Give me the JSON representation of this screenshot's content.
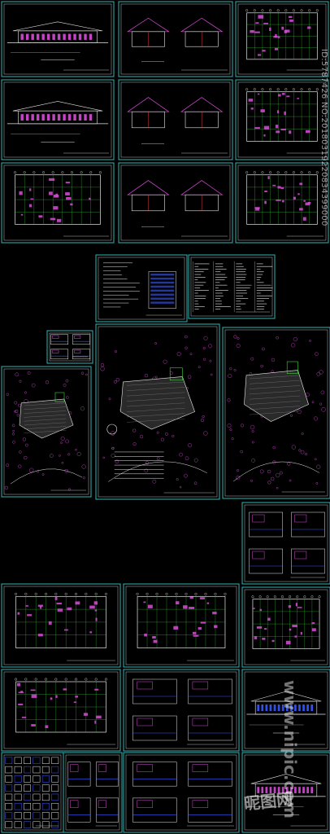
{
  "image_kind": "collage of architectural CAD drawing sheets on black background",
  "colors": {
    "frame": "#2fb6b6",
    "magenta": "#d94cd9",
    "white": "#e8e8e8",
    "green": "#3fd63f",
    "blue": "#3a5bff",
    "yellow": "#d8d84a",
    "red": "#e04040"
  },
  "sheets": [
    {
      "name": "sheet-elevation-1",
      "kind": "elevation"
    },
    {
      "name": "sheet-elevation-pair-1",
      "kind": "elevation-pair"
    },
    {
      "name": "sheet-plan-1",
      "kind": "plan"
    },
    {
      "name": "sheet-elevation-2",
      "kind": "elevation"
    },
    {
      "name": "sheet-sections-1",
      "kind": "sections"
    },
    {
      "name": "sheet-plan-2",
      "kind": "plan"
    },
    {
      "name": "sheet-roof-plan",
      "kind": "roof-plan"
    },
    {
      "name": "sheet-sections-2",
      "kind": "sections"
    },
    {
      "name": "sheet-plan-3",
      "kind": "plan"
    },
    {
      "name": "sheet-notes-1",
      "kind": "notes"
    },
    {
      "name": "sheet-notes-2",
      "kind": "table"
    },
    {
      "name": "sheet-detail-small",
      "kind": "detail"
    },
    {
      "name": "sheet-site-plan-1",
      "kind": "site-plan"
    },
    {
      "name": "sheet-master-plan",
      "kind": "site-plan"
    },
    {
      "name": "sheet-site-plan-2",
      "kind": "site-plan"
    },
    {
      "name": "sheet-floor-plan-a",
      "kind": "plan"
    },
    {
      "name": "sheet-floor-plan-b",
      "kind": "plan"
    },
    {
      "name": "sheet-details-a",
      "kind": "detail"
    },
    {
      "name": "sheet-floor-plan-c",
      "kind": "plan"
    },
    {
      "name": "sheet-floor-plan-d",
      "kind": "plan"
    },
    {
      "name": "sheet-details-b",
      "kind": "detail"
    },
    {
      "name": "sheet-elevation-color",
      "kind": "elevation"
    },
    {
      "name": "sheet-furniture",
      "kind": "blocks"
    },
    {
      "name": "sheet-details-c",
      "kind": "detail"
    },
    {
      "name": "sheet-details-d",
      "kind": "detail"
    },
    {
      "name": "sheet-elevation-3",
      "kind": "elevation"
    }
  ],
  "watermark": {
    "id_text": "ID:5787426 NO:20180319220834399000",
    "brand": "昵图网",
    "url": "www.nipic.com"
  }
}
